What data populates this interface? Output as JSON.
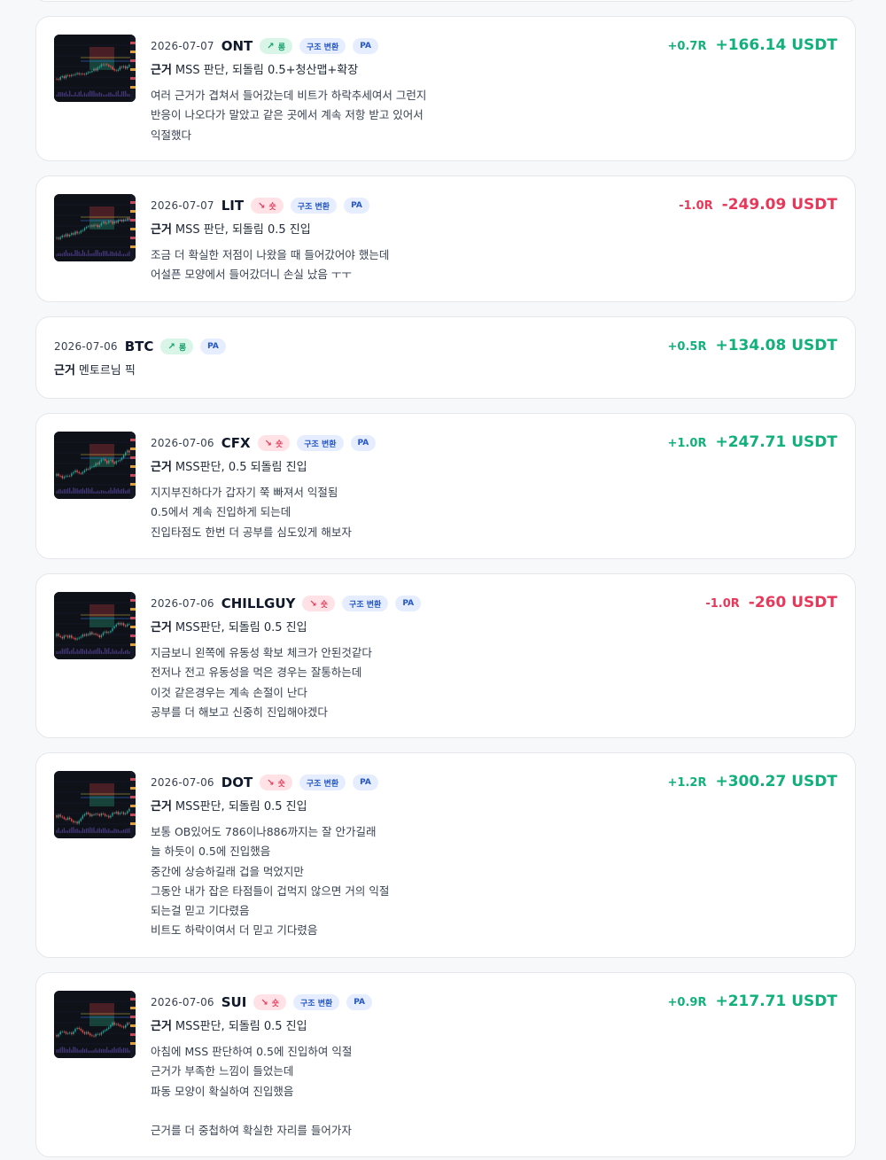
{
  "basis_label": "근거",
  "trades": [
    {
      "date": "2026-07-07",
      "symbol": "ONT",
      "direction": "long",
      "direction_label": "롱",
      "tags": [
        "구조 변환",
        "PA"
      ],
      "has_image": true,
      "basis": "MSS 판단, 되돌림 0.5+청산맵+확장",
      "notes": [
        "여러 근거가 겹쳐서 들어갔는데 비트가 하락추세여서 그런지",
        "반응이 나오다가 말았고 같은 곳에서 계속 저항 받고 있어서",
        "익절했다"
      ],
      "r": "+0.7R",
      "pnl": "+166.14 USDT",
      "positive": true
    },
    {
      "date": "2026-07-07",
      "symbol": "LIT",
      "direction": "short",
      "direction_label": "숏",
      "tags": [
        "구조 변환",
        "PA"
      ],
      "has_image": true,
      "basis": "MSS 판단, 되돌림 0.5 진입",
      "notes": [
        "조금 더 확실한 저점이 나왔을 때 들어갔어야 했는데",
        "어설픈 모양에서 들어갔더니 손실 났음 ㅜㅜ"
      ],
      "r": "-1.0R",
      "pnl": "-249.09 USDT",
      "positive": false
    },
    {
      "date": "2026-07-06",
      "symbol": "BTC",
      "direction": "long",
      "direction_label": "롱",
      "tags": [
        "PA"
      ],
      "has_image": false,
      "basis": "멘토르님 픽",
      "notes": [],
      "r": "+0.5R",
      "pnl": "+134.08 USDT",
      "positive": true
    },
    {
      "date": "2026-07-06",
      "symbol": "CFX",
      "direction": "short",
      "direction_label": "숏",
      "tags": [
        "구조 변환",
        "PA"
      ],
      "has_image": true,
      "basis": "MSS판단, 0.5 되돌림 진입",
      "notes": [
        "지지부진하다가 갑자기 쭉 빠져서 익절됨",
        "0.5에서 계속 진입하게 되는데",
        "진입타점도 한번 더 공부를 심도있게 해보자"
      ],
      "r": "+1.0R",
      "pnl": "+247.71 USDT",
      "positive": true
    },
    {
      "date": "2026-07-06",
      "symbol": "CHILLGUY",
      "direction": "short",
      "direction_label": "숏",
      "tags": [
        "구조 변환",
        "PA"
      ],
      "has_image": true,
      "basis": "MSS판단, 되돌림 0.5 진입",
      "notes": [
        "지금보니 왼쪽에 유동성 확보 체크가 안된것같다",
        "전저나 전고 유동성을 먹은 경우는 잘통하는데",
        "이것 같은경우는 계속 손절이 난다",
        "공부를 더 해보고 신중히 진입해야겠다"
      ],
      "r": "-1.0R",
      "pnl": "-260 USDT",
      "positive": false
    },
    {
      "date": "2026-07-06",
      "symbol": "DOT",
      "direction": "short",
      "direction_label": "숏",
      "tags": [
        "구조 변환",
        "PA"
      ],
      "has_image": true,
      "basis": "MSS판단, 되돌림 0.5 진입",
      "notes": [
        "보통 OB있어도 786이나886까지는 잘 안가길래",
        "늘 하듯이 0.5에 진입했음",
        "중간에 상승하길래 겁을 먹었지만",
        "그동안 내가 잡은 타점들이 겁먹지 않으면 거의 익절",
        "되는걸 믿고 기다렸음",
        "비트도 하락이여서 더 믿고 기다렸음"
      ],
      "r": "+1.2R",
      "pnl": "+300.27 USDT",
      "positive": true
    },
    {
      "date": "2026-07-06",
      "symbol": "SUI",
      "direction": "short",
      "direction_label": "숏",
      "tags": [
        "구조 변환",
        "PA"
      ],
      "has_image": true,
      "basis": "MSS판단, 되돌림 0.5 진입",
      "notes": [
        "아침에 MSS 판단하여 0.5에 진입하여 익절",
        "근거가 부족한 느낌이 들었는데",
        "파동 모양이 확실하여 진입했음",
        "",
        "근거를 더 중첩하여 확실한 자리를 들어가자"
      ],
      "r": "+0.9R",
      "pnl": "+217.71 USDT",
      "positive": true
    }
  ]
}
